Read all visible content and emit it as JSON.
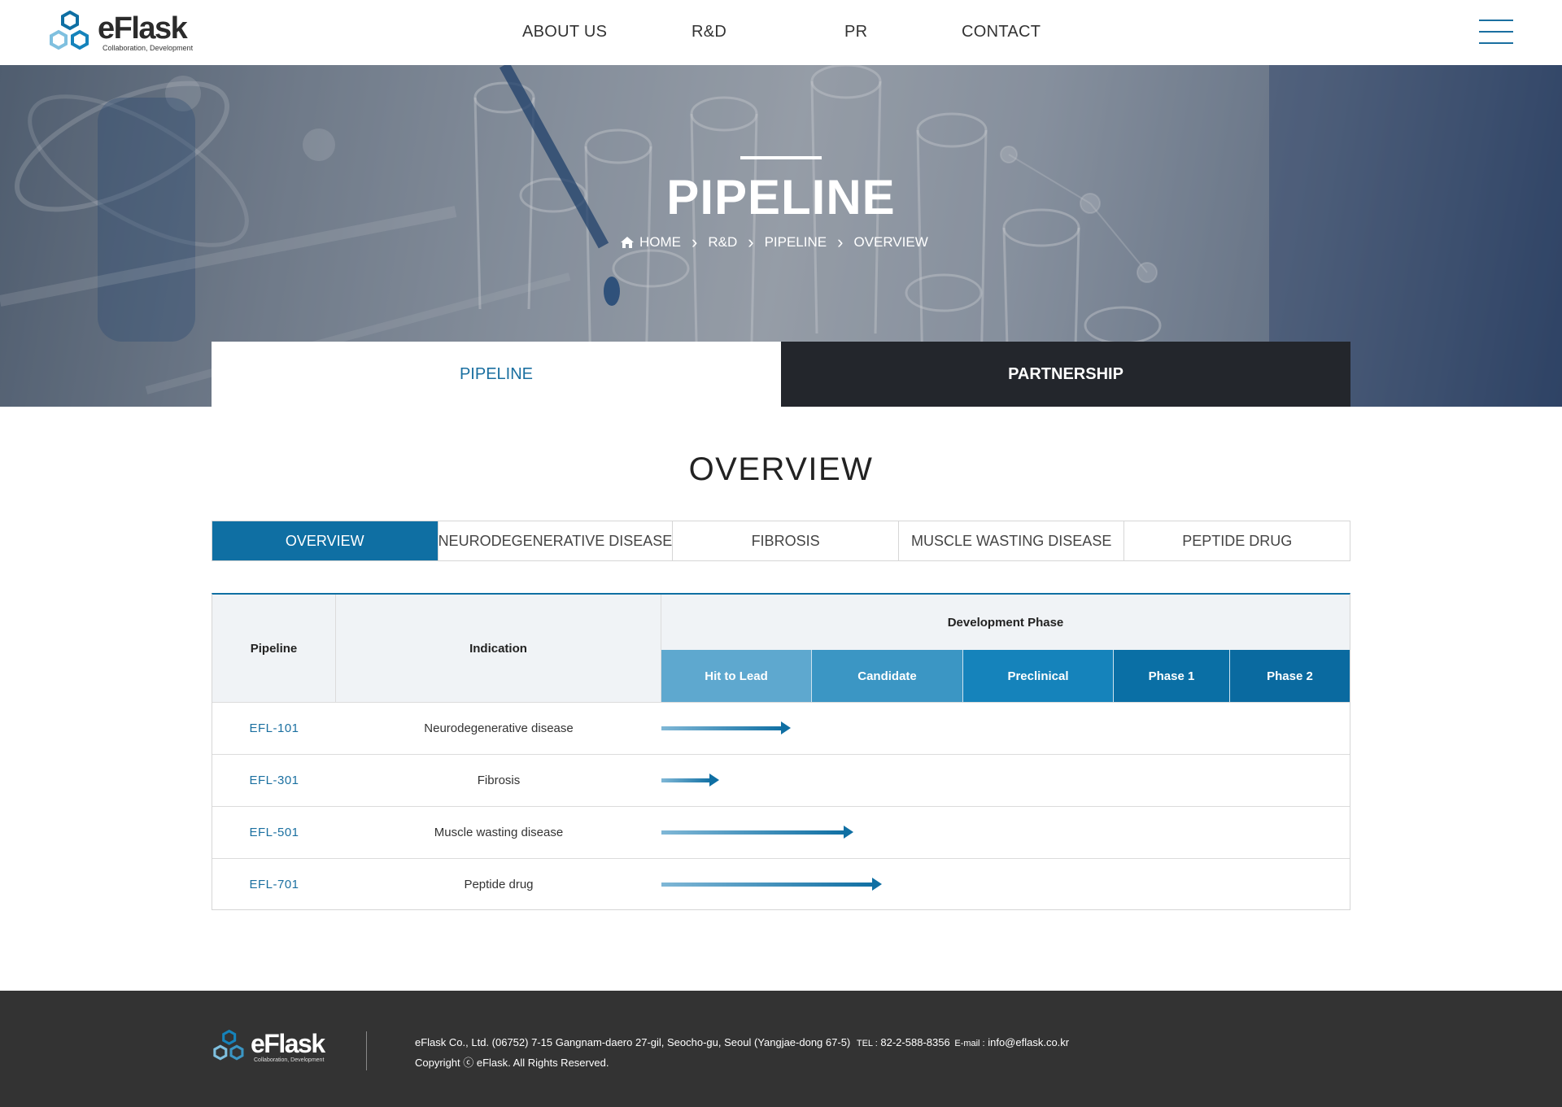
{
  "brand": {
    "name": "eFlask",
    "tagline": "Collaboration, Development",
    "colors": {
      "primary": "#0f6fa3",
      "dark": "#23262c",
      "footer": "#333333"
    }
  },
  "nav": {
    "items": [
      {
        "label": "ABOUT US"
      },
      {
        "label": "R&D"
      },
      {
        "label": "PR"
      },
      {
        "label": "CONTACT"
      }
    ],
    "menu_icon": "hamburger-icon"
  },
  "hero": {
    "title": "PIPELINE",
    "breadcrumb": [
      "HOME",
      "R&D",
      "PIPELINE",
      "OVERVIEW"
    ],
    "home_icon": "home-icon",
    "separator_icon": "chevron-right-icon"
  },
  "subtabs": [
    {
      "label": "PIPELINE",
      "active": true
    },
    {
      "label": "PARTNERSHIP",
      "active": false
    }
  ],
  "section": {
    "title": "OVERVIEW"
  },
  "category_tabs": [
    {
      "label": "OVERVIEW",
      "active": true
    },
    {
      "label": "NEURODEGENERATIVE DISEASE",
      "active": false
    },
    {
      "label": "FIBROSIS",
      "active": false
    },
    {
      "label": "MUSCLE WASTING DISEASE",
      "active": false
    },
    {
      "label": "PEPTIDE DRUG",
      "active": false
    }
  ],
  "table": {
    "headers": {
      "pipeline": "Pipeline",
      "indication": "Indication",
      "development_phase": "Development Phase"
    },
    "phases": [
      {
        "label": "Hit to Lead",
        "color": "#5ea8cf"
      },
      {
        "label": "Candidate",
        "color": "#3b96c4"
      },
      {
        "label": "Preclinical",
        "color": "#1583bb"
      },
      {
        "label": "Phase 1",
        "color": "#0a6fa5"
      },
      {
        "label": "Phase 2",
        "color": "#0a6aa0"
      }
    ],
    "rows": [
      {
        "pipeline": "EFL-101",
        "indication": "Neurodegenerative disease",
        "progress_phases": 0.82
      },
      {
        "pipeline": "EFL-301",
        "indication": "Fibrosis",
        "progress_phases": 0.34
      },
      {
        "pipeline": "EFL-501",
        "indication": "Muscle wasting disease",
        "progress_phases": 1.24
      },
      {
        "pipeline": "EFL-701",
        "indication": "Peptide drug",
        "progress_phases": 1.43
      }
    ]
  },
  "footer": {
    "address": "eFlask Co., Ltd. (06752) 7-15 Gangnam-daero 27-gil, Seocho-gu, Seoul (Yangjae-dong 67-5)",
    "tel_label": "TEL :",
    "tel": "82-2-588-8356",
    "email_label": "E-mail :",
    "email": "info@eflask.co.kr",
    "copyright": "Copyright ⓒ eFlask. All Rights Reserved."
  }
}
